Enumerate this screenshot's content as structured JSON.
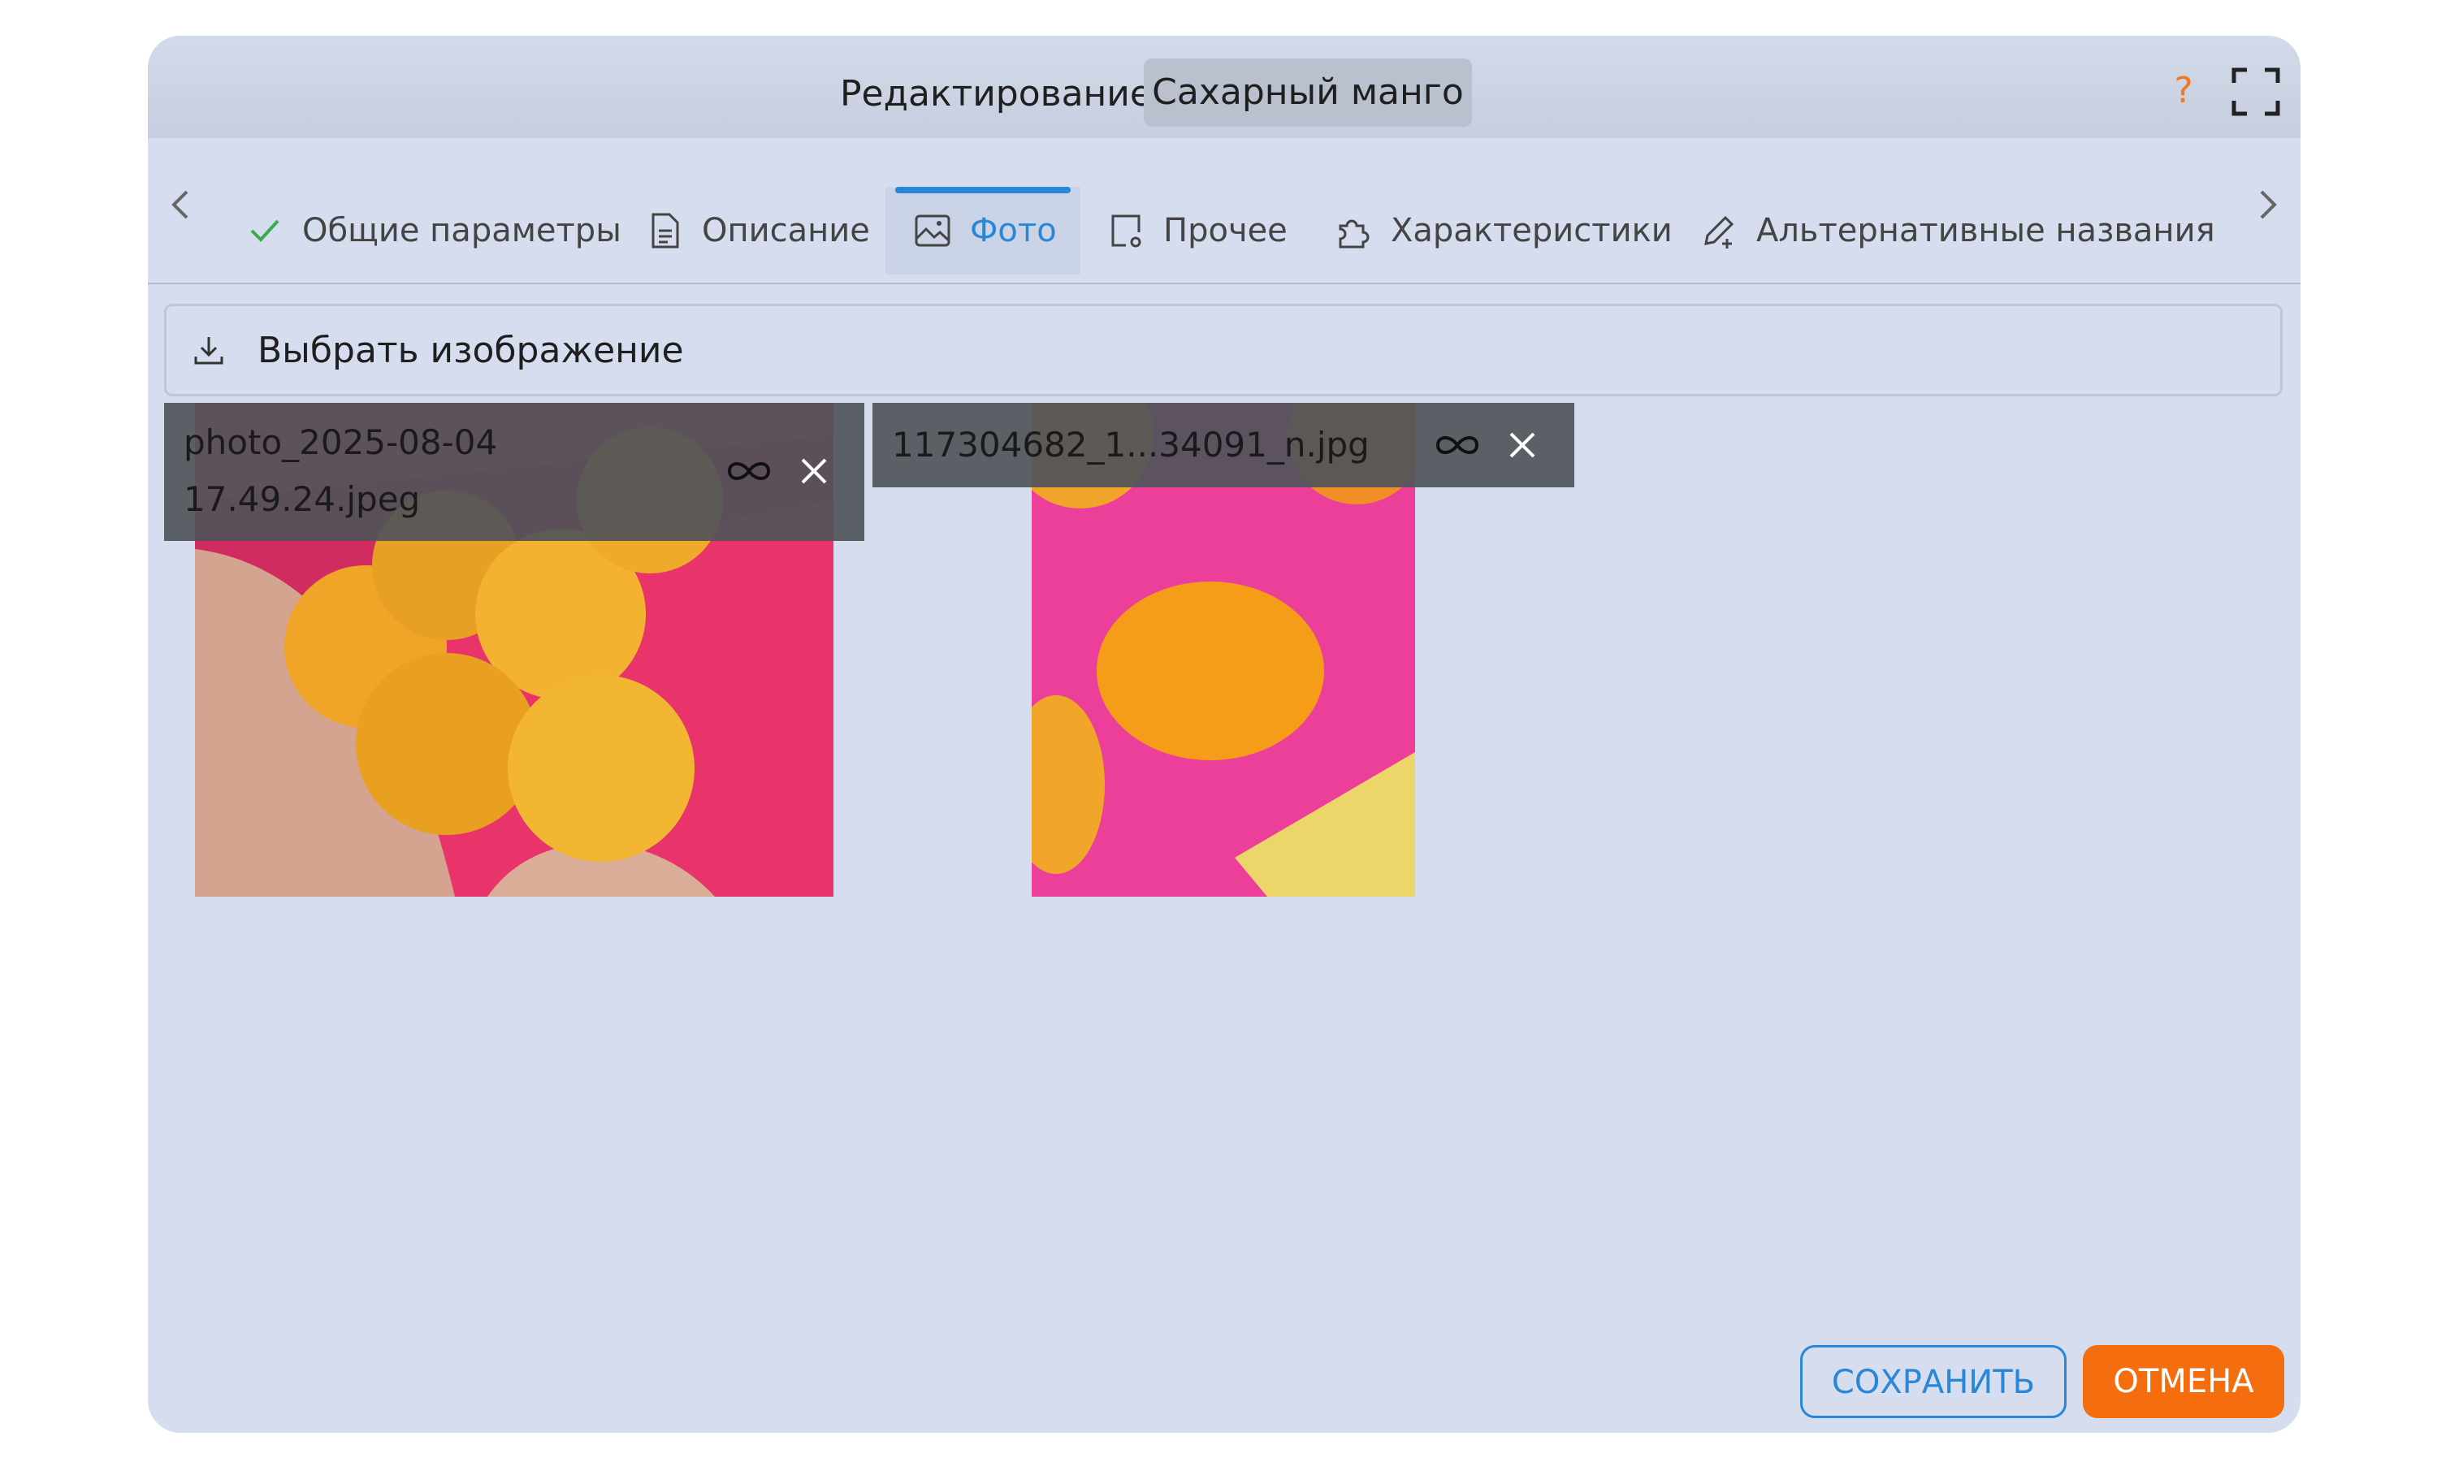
{
  "dialog": {
    "title": "Редактирование",
    "item_name": "Сахарный манго",
    "help_symbol": "?",
    "colors": {
      "accent": "#2a86d6",
      "cancel": "#f46e0f",
      "help": "#f07a1e",
      "check": "#3aaa4a"
    }
  },
  "tabs": [
    {
      "label": "Общие параметры",
      "icon": "check-icon",
      "active": false
    },
    {
      "label": "Описание",
      "icon": "document-icon",
      "active": false
    },
    {
      "label": "Фото",
      "icon": "image-icon",
      "active": true
    },
    {
      "label": "Прочее",
      "icon": "settings-page-icon",
      "active": false
    },
    {
      "label": "Характеристики",
      "icon": "puzzle-icon",
      "active": false
    },
    {
      "label": "Альтернативные названия",
      "icon": "edit-plus-icon",
      "active": false
    }
  ],
  "picker": {
    "label": "Выбрать изображение",
    "icon": "download-icon"
  },
  "photos": [
    {
      "filename_line1": "photo_2025-08-04",
      "filename_line2": "17.49.24.jpeg"
    },
    {
      "filename": "117304682_1...34091_n.jpg"
    }
  ],
  "photo_actions": {
    "link_icon": "infinity-icon",
    "remove_icon": "close-icon"
  },
  "footer": {
    "save_label": "СОХРАНИТЬ",
    "cancel_label": "ОТМЕНА"
  }
}
